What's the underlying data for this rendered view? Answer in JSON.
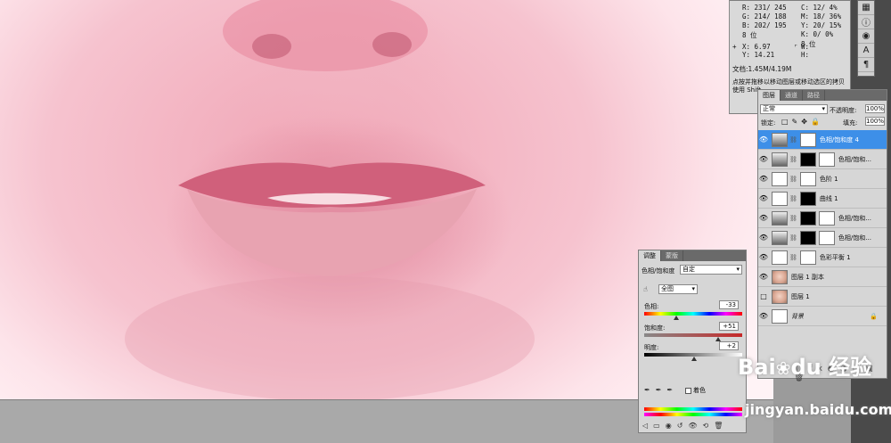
{
  "info_panel": {
    "r_label": "R:",
    "r_value": "231/ 245",
    "g_label": "G:",
    "g_value": "214/ 188",
    "b_label": "B:",
    "b_value": "202/ 195",
    "c_label": "C:",
    "c_value": "12/ 4%",
    "m_label": "M:",
    "m_value": "18/ 36%",
    "y_label": "Y:",
    "y_value": "20/ 15%",
    "k_label": "K:",
    "k_value": "0/ 0%",
    "bit_left": "8 位",
    "bit_right": "8 位",
    "x_label": "X:",
    "x_value": "6.97",
    "yy_label": "Y:",
    "yy_value": "14.21",
    "w_label": "W:",
    "h_label": "H:",
    "doc_size": "文档:1.45M/4.19M",
    "hint_line1": "点按并拖移以移动图层或移动选区的拷贝",
    "hint_line2": "使用 Shift..."
  },
  "layers_panel": {
    "tabs": [
      "图层",
      "通道",
      "路径"
    ],
    "blend_mode": "正常",
    "opacity_label": "不透明度:",
    "opacity_value": "100%",
    "lock_label": "锁定:",
    "fill_label": "填充:",
    "fill_value": "100%",
    "layers": [
      {
        "name": "色相/饱和度 4"
      },
      {
        "name": "色相/饱和..."
      },
      {
        "name": "色阶 1"
      },
      {
        "name": "曲线 1"
      },
      {
        "name": "色相/饱和..."
      },
      {
        "name": "色相/饱和..."
      },
      {
        "name": "色彩平衡 1"
      },
      {
        "name": "图层 1 副本"
      },
      {
        "name": "图层 1"
      },
      {
        "name": "背景"
      }
    ]
  },
  "properties_panel": {
    "tabs": [
      "调整",
      "蒙版"
    ],
    "adjustment": "色相/饱和度",
    "preset": "自定",
    "channel": "全图",
    "hue_label": "色相:",
    "hue_value": "-33",
    "sat_label": "饱和度:",
    "sat_value": "+51",
    "light_label": "明度:",
    "light_value": "+2",
    "colorize_label": "着色"
  },
  "watermark": {
    "brand": "Bai du 经验",
    "url": "jingyan.baidu.com"
  }
}
